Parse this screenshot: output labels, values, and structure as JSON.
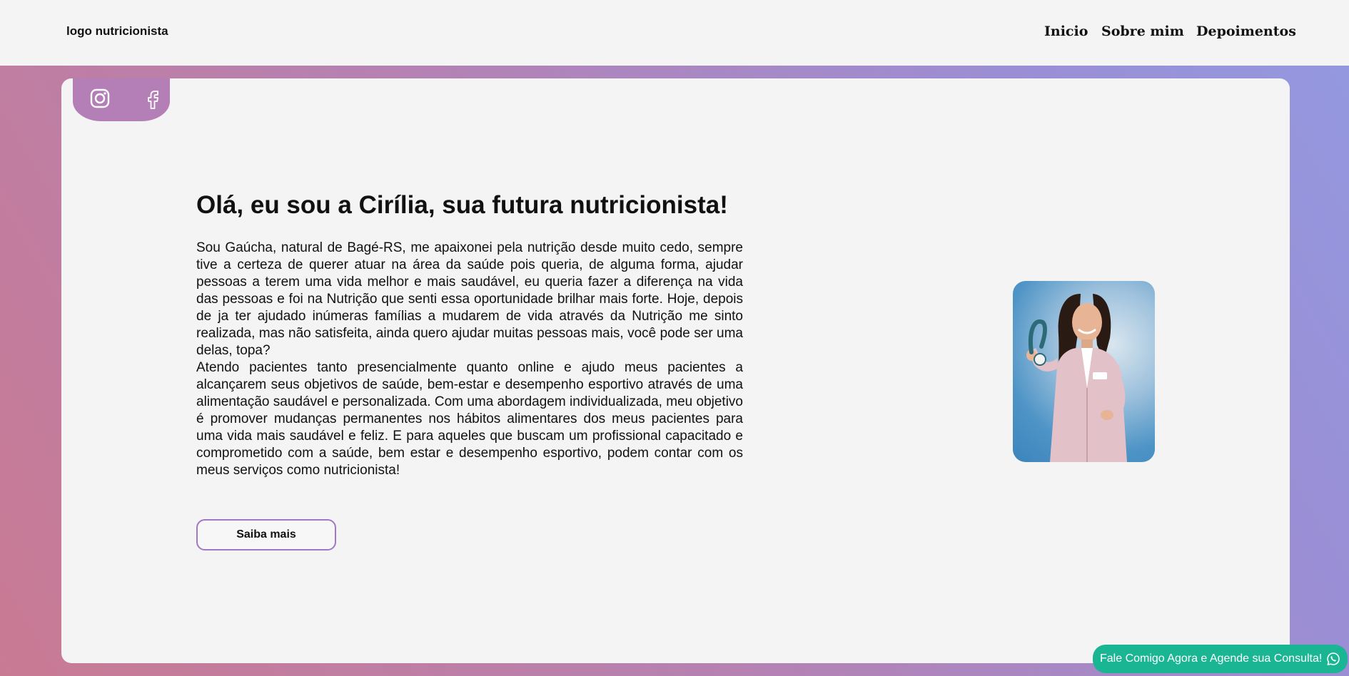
{
  "header": {
    "logo_text": "logo nutricionista",
    "nav": [
      "Inicio",
      "Sobre mim",
      "Depoimentos"
    ]
  },
  "social": {
    "icons": [
      "instagram-icon",
      "facebook-icon"
    ]
  },
  "hero": {
    "title": "Olá, eu sou a Cirília, sua futura nutricionista!",
    "paragraph_1": "Sou Gaúcha, natural de Bagé-RS, me apaixonei pela nutrição desde muito cedo, sempre tive a certeza de querer atuar na área da saúde pois queria, de alguma forma, ajudar pessoas a terem uma vida melhor e mais saudável, eu queria fazer a diferença na vida das pessoas e foi na Nutrição que senti essa oportunidade brilhar mais forte. Hoje, depois de ja ter ajudado inúmeras famílias a mudarem de vida através da Nutrição me sinto realizada, mas não satisfeita, ainda quero ajudar muitas pessoas mais, você pode ser uma delas, topa?",
    "paragraph_2": "Atendo pacientes tanto presencialmente quanto online e ajudo meus pacientes a alcançarem seus objetivos de saúde, bem-estar e desempenho esportivo através de uma alimentação saudável e personalizada. Com uma abordagem individualizada, meu objetivo é promover mudanças permanentes nos hábitos alimentares dos meus pacientes para uma vida mais saudável e feliz. E para aqueles que buscam um profissional capacitado e comprometido com a saúde, bem estar e desempenho esportivo, podem contar com os meus serviços como nutricionista!",
    "cta_label": "Saiba mais"
  },
  "whatsapp": {
    "label": "Fale Comigo Agora e Agende sua Consulta!"
  },
  "colors": {
    "accent": "#b47fb6",
    "button_border": "#a277c4",
    "whatsapp": "#1ab694",
    "card": "#f4f4f4"
  }
}
